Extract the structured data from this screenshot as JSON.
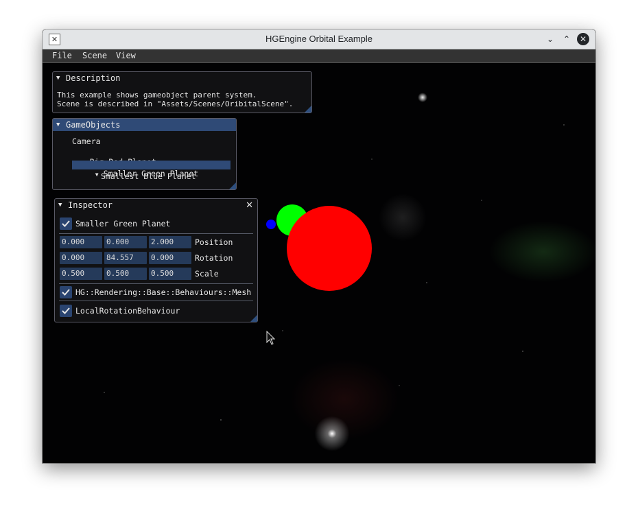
{
  "window": {
    "title": "HGEngine Orbital Example",
    "app_icon_glyph": "✕",
    "minimize_glyph": "⌄",
    "maximize_glyph": "⌃",
    "close_glyph": "✕"
  },
  "menubar": {
    "items": [
      "File",
      "Scene",
      "View"
    ]
  },
  "description": {
    "title": "Description",
    "lines": [
      "This example shows gameobject parent system.",
      "Scene is described in \"Assets/Scenes/OribitalScene\"."
    ]
  },
  "gameobjects": {
    "title": "GameObjects",
    "items": [
      "Camera",
      "Big Red Planet",
      "Smaller Green Planet",
      "Smallest Blue Planet"
    ],
    "selected": "Smaller Green Planet"
  },
  "inspector": {
    "title": "Inspector",
    "object_name": "Smaller Green Planet",
    "enabled": true,
    "transform": [
      {
        "label": "Position",
        "values": [
          "0.000",
          "0.000",
          "2.000"
        ]
      },
      {
        "label": "Rotation",
        "values": [
          "0.000",
          "84.557",
          "0.000"
        ]
      },
      {
        "label": "Scale",
        "values": [
          "0.500",
          "0.500",
          "0.500"
        ]
      }
    ],
    "behaviours": [
      {
        "name": "HG::Rendering::Base::Behaviours::Mesh",
        "enabled": true
      },
      {
        "name": "LocalRotationBehaviour",
        "enabled": true
      }
    ]
  },
  "colors": {
    "red_planet": "#ff0000",
    "green_planet": "#00ff00",
    "blue_planet": "#0000ff",
    "accent": "#2f4a76"
  }
}
